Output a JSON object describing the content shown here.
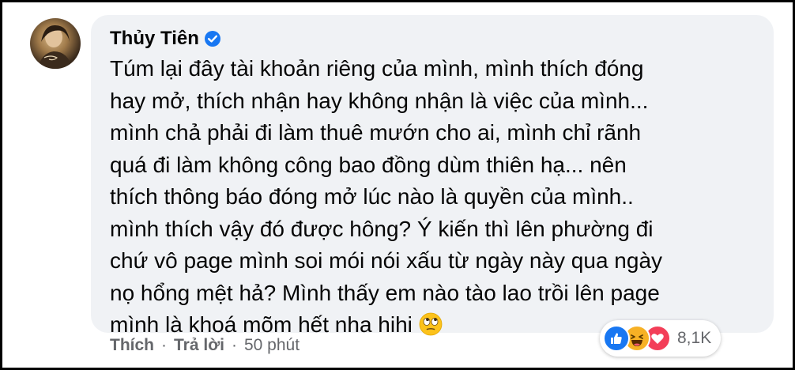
{
  "comment": {
    "author": "Thủy Tiên",
    "verified": true,
    "lines": [
      "Túm lại đây tài khoản riêng của mình, mình thích đóng",
      "hay mở, thích nhận hay không nhận là việc của mình...",
      "mình chả phải đi làm thuê mướn cho ai, mình chỉ rãnh",
      "quá đi làm không công bao đồng dùm thiên hạ... nên",
      "thích thông báo đóng mở lúc nào là quyền của mình..",
      "mình thích vậy đó được hông? Ý kiến thì lên phường đi",
      "chứ vô page mình soi mói nói xấu từ ngày này qua ngày",
      "nọ hổng mệt hả? Mình thấy em nào tào lao trồi lên page",
      "mình là khoá mõm hết nha hihi"
    ],
    "trailing_emoji": "face-with-rolling-eyes-emoji"
  },
  "actions": {
    "like_label": "Thích",
    "separator": "·",
    "reply_label": "Trả lời",
    "time": "50 phút"
  },
  "reactions": {
    "icons": [
      "like-icon",
      "haha-icon",
      "love-icon"
    ],
    "count": "8,1K"
  },
  "colors": {
    "bubble": "#f0f2f5",
    "text": "#050505",
    "secondary": "#65676b",
    "verified": "#1877f2",
    "like": "#1877f2",
    "haha": "#f7b125",
    "love": "#f33e58"
  }
}
